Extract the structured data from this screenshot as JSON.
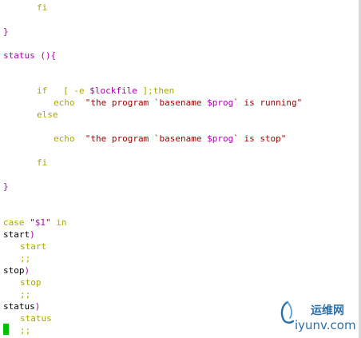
{
  "editor": {
    "lines": {
      "l1": {
        "a": "fi"
      },
      "l2": {
        "a": "}"
      },
      "l3": {
        "a": "status",
        "b": " (){"
      },
      "l4": {
        "a": "if",
        "b": "   [ -e ",
        "c": "$lockfile",
        "d": " ];then"
      },
      "l5": {
        "a": "echo",
        "b": "  ",
        "c": "\"the program `basename ",
        "d": "$prog",
        "e": "` is running\""
      },
      "l6": {
        "a": "else"
      },
      "l7": {
        "a": "echo",
        "b": "  ",
        "c": "\"the program `basename ",
        "d": "$prog",
        "e": "` is stop\""
      },
      "l8": {
        "a": "fi"
      },
      "l9": {
        "a": "}"
      },
      "l10": {
        "a": "case",
        "b": " ",
        "c": "\"",
        "d": "$1",
        "e": "\"",
        "f": " in"
      },
      "l11": {
        "a": "start",
        "b": ")"
      },
      "l12": {
        "a": "start"
      },
      "l13": {
        "a": ";;"
      },
      "l14": {
        "a": "stop",
        "b": ")"
      },
      "l15": {
        "a": "stop"
      },
      "l16": {
        "a": ";;"
      },
      "l17": {
        "a": "status",
        "b": ")"
      },
      "l18": {
        "a": "status"
      },
      "l19": {
        "a": ";;"
      }
    }
  },
  "watermark": {
    "brand_cn": "运维网",
    "domain": "iyunv.com"
  },
  "colors": {
    "keyword": "#a8a800",
    "brace": "#b000b0",
    "string": "#a80000",
    "cursor": "#00c000",
    "watermark": "#2c6fa8"
  }
}
